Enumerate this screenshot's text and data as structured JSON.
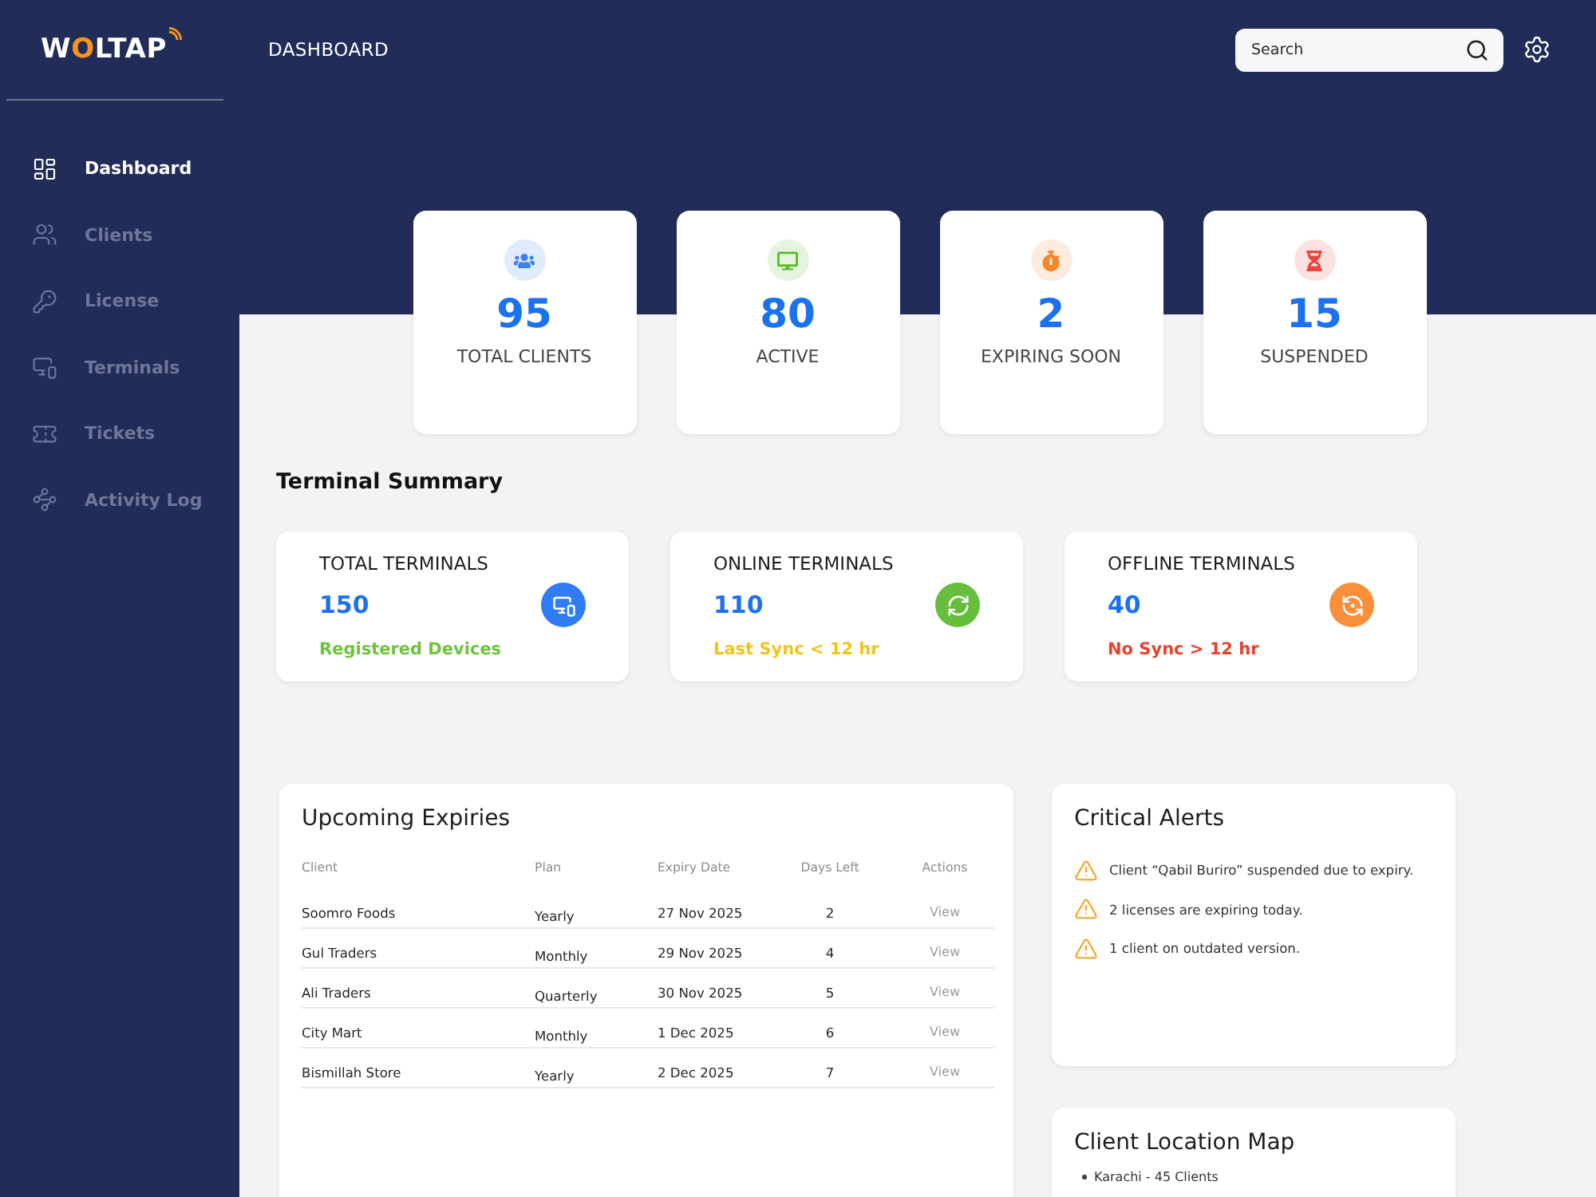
{
  "sidebar": {
    "logo": "WOLTAP",
    "items": [
      {
        "label": "Dashboard",
        "selected": true
      },
      {
        "label": "Clients",
        "selected": false
      },
      {
        "label": "License",
        "selected": false
      },
      {
        "label": "Terminals",
        "selected": false
      },
      {
        "label": "Tickets",
        "selected": false
      },
      {
        "label": "Activity Log",
        "selected": false
      }
    ]
  },
  "header": {
    "title": "DASHBOARD",
    "search": {
      "placeholder": "Search"
    }
  },
  "stats": [
    {
      "value": "95",
      "label": "TOTAL CLIENTS",
      "color": "#3b7ff0"
    },
    {
      "value": "80",
      "label": "ACTIVE",
      "color": "#5dbb2f"
    },
    {
      "value": "2",
      "label": "EXPIRING SOON",
      "color": "#f5862a"
    },
    {
      "value": "15",
      "label": "SUSPENDED",
      "color": "#e8473c"
    }
  ],
  "terminal_summary": {
    "title": "Terminal Summary",
    "cards": [
      {
        "title": "TOTAL TERMINALS",
        "value": "150",
        "color": "#2f7cf6",
        "note": {
          "text": "Registered Devices",
          "color": "#6cc33a"
        }
      },
      {
        "title": "ONLINE TERMINALS",
        "value": "110",
        "color": "#67bd3c",
        "note": {
          "text": "Last Sync < 12 hr",
          "color": "#f2c318"
        }
      },
      {
        "title": "OFFLINE TERMINALS",
        "value": "40",
        "color": "#f98f3a",
        "note": {
          "text": "No Sync > 12 hr",
          "color": "#e8412c"
        }
      }
    ]
  },
  "upcoming_expiries": {
    "title": "Upcoming Expiries",
    "columns": [
      "Client",
      "Plan",
      "Expiry Date",
      "Days Left",
      "Actions"
    ],
    "rows": [
      {
        "client": "Soomro Foods",
        "plan": "Yearly",
        "expiry_date": "27 Nov 2025",
        "days_left": "2",
        "action": "View"
      },
      {
        "client": "Gul Traders",
        "plan": "Monthly",
        "expiry_date": "29 Nov 2025",
        "days_left": "4",
        "action": "View"
      },
      {
        "client": "Ali Traders",
        "plan": "Quarterly",
        "expiry_date": "30 Nov 2025",
        "days_left": "5",
        "action": "View"
      },
      {
        "client": "City Mart",
        "plan": "Monthly",
        "expiry_date": "1 Dec 2025",
        "days_left": "6",
        "action": "View"
      },
      {
        "client": "Bismillah Store",
        "plan": "Yearly",
        "expiry_date": "2 Dec 2025",
        "days_left": "7",
        "action": "View"
      }
    ]
  },
  "critical_alerts": {
    "title": "Critical Alerts",
    "items": [
      "Client “Qabil Buriro” suspended due to expiry.",
      "2 licenses are expiring today.",
      "1 client on outdated version."
    ]
  },
  "client_location_map": {
    "title": "Client Location Map",
    "items": [
      "Karachi - 45 Clients"
    ]
  }
}
